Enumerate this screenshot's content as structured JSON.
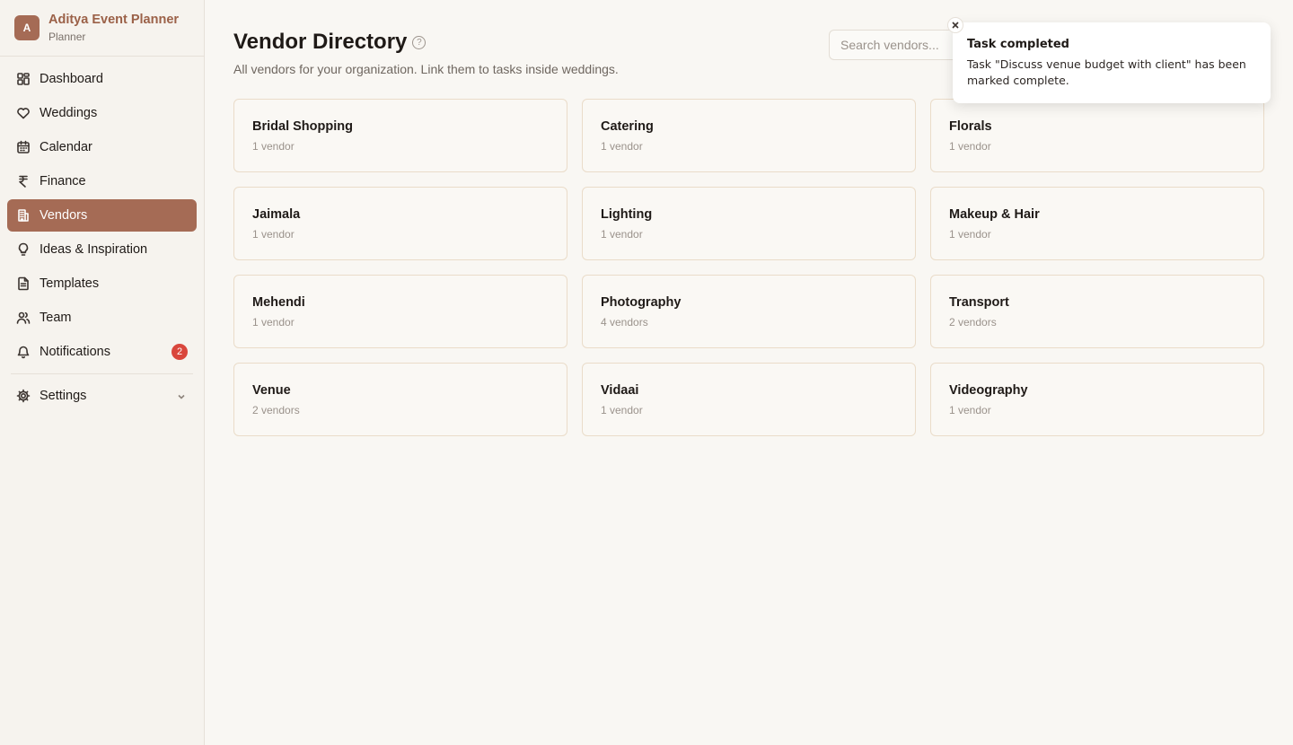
{
  "brand": {
    "avatar_letter": "A",
    "name": "Aditya Event Planner",
    "role": "Planner"
  },
  "sidebar": {
    "items": [
      {
        "label": "Dashboard",
        "icon": "grid-icon"
      },
      {
        "label": "Weddings",
        "icon": "heart-icon"
      },
      {
        "label": "Calendar",
        "icon": "calendar-icon"
      },
      {
        "label": "Finance",
        "icon": "rupee-icon"
      },
      {
        "label": "Vendors",
        "icon": "building-icon",
        "active": true
      },
      {
        "label": "Ideas & Inspiration",
        "icon": "lightbulb-icon"
      },
      {
        "label": "Templates",
        "icon": "document-icon"
      },
      {
        "label": "Team",
        "icon": "users-icon"
      },
      {
        "label": "Notifications",
        "icon": "bell-icon",
        "badge": "2"
      }
    ],
    "settings": {
      "label": "Settings",
      "icon": "gear-icon"
    }
  },
  "header": {
    "title": "Vendor Directory",
    "help_glyph": "?",
    "subtitle": "All vendors for your organization. Link them to tasks inside weddings."
  },
  "search": {
    "placeholder": "Search vendors...",
    "value": ""
  },
  "categories": [
    {
      "name": "Bridal Shopping",
      "count": "1 vendor"
    },
    {
      "name": "Catering",
      "count": "1 vendor"
    },
    {
      "name": "Florals",
      "count": "1 vendor"
    },
    {
      "name": "Jaimala",
      "count": "1 vendor"
    },
    {
      "name": "Lighting",
      "count": "1 vendor"
    },
    {
      "name": "Makeup & Hair",
      "count": "1 vendor"
    },
    {
      "name": "Mehendi",
      "count": "1 vendor"
    },
    {
      "name": "Photography",
      "count": "4 vendors"
    },
    {
      "name": "Transport",
      "count": "2 vendors"
    },
    {
      "name": "Venue",
      "count": "2 vendors"
    },
    {
      "name": "Vidaai",
      "count": "1 vendor"
    },
    {
      "name": "Videography",
      "count": "1 vendor"
    }
  ],
  "toast": {
    "title": "Task completed",
    "description": "Task \"Discuss venue budget with client\" has been marked complete."
  },
  "colors": {
    "accent": "#a56b55",
    "brand_text": "#9b6148",
    "badge": "#d9463c",
    "background": "#f9f7f3"
  }
}
